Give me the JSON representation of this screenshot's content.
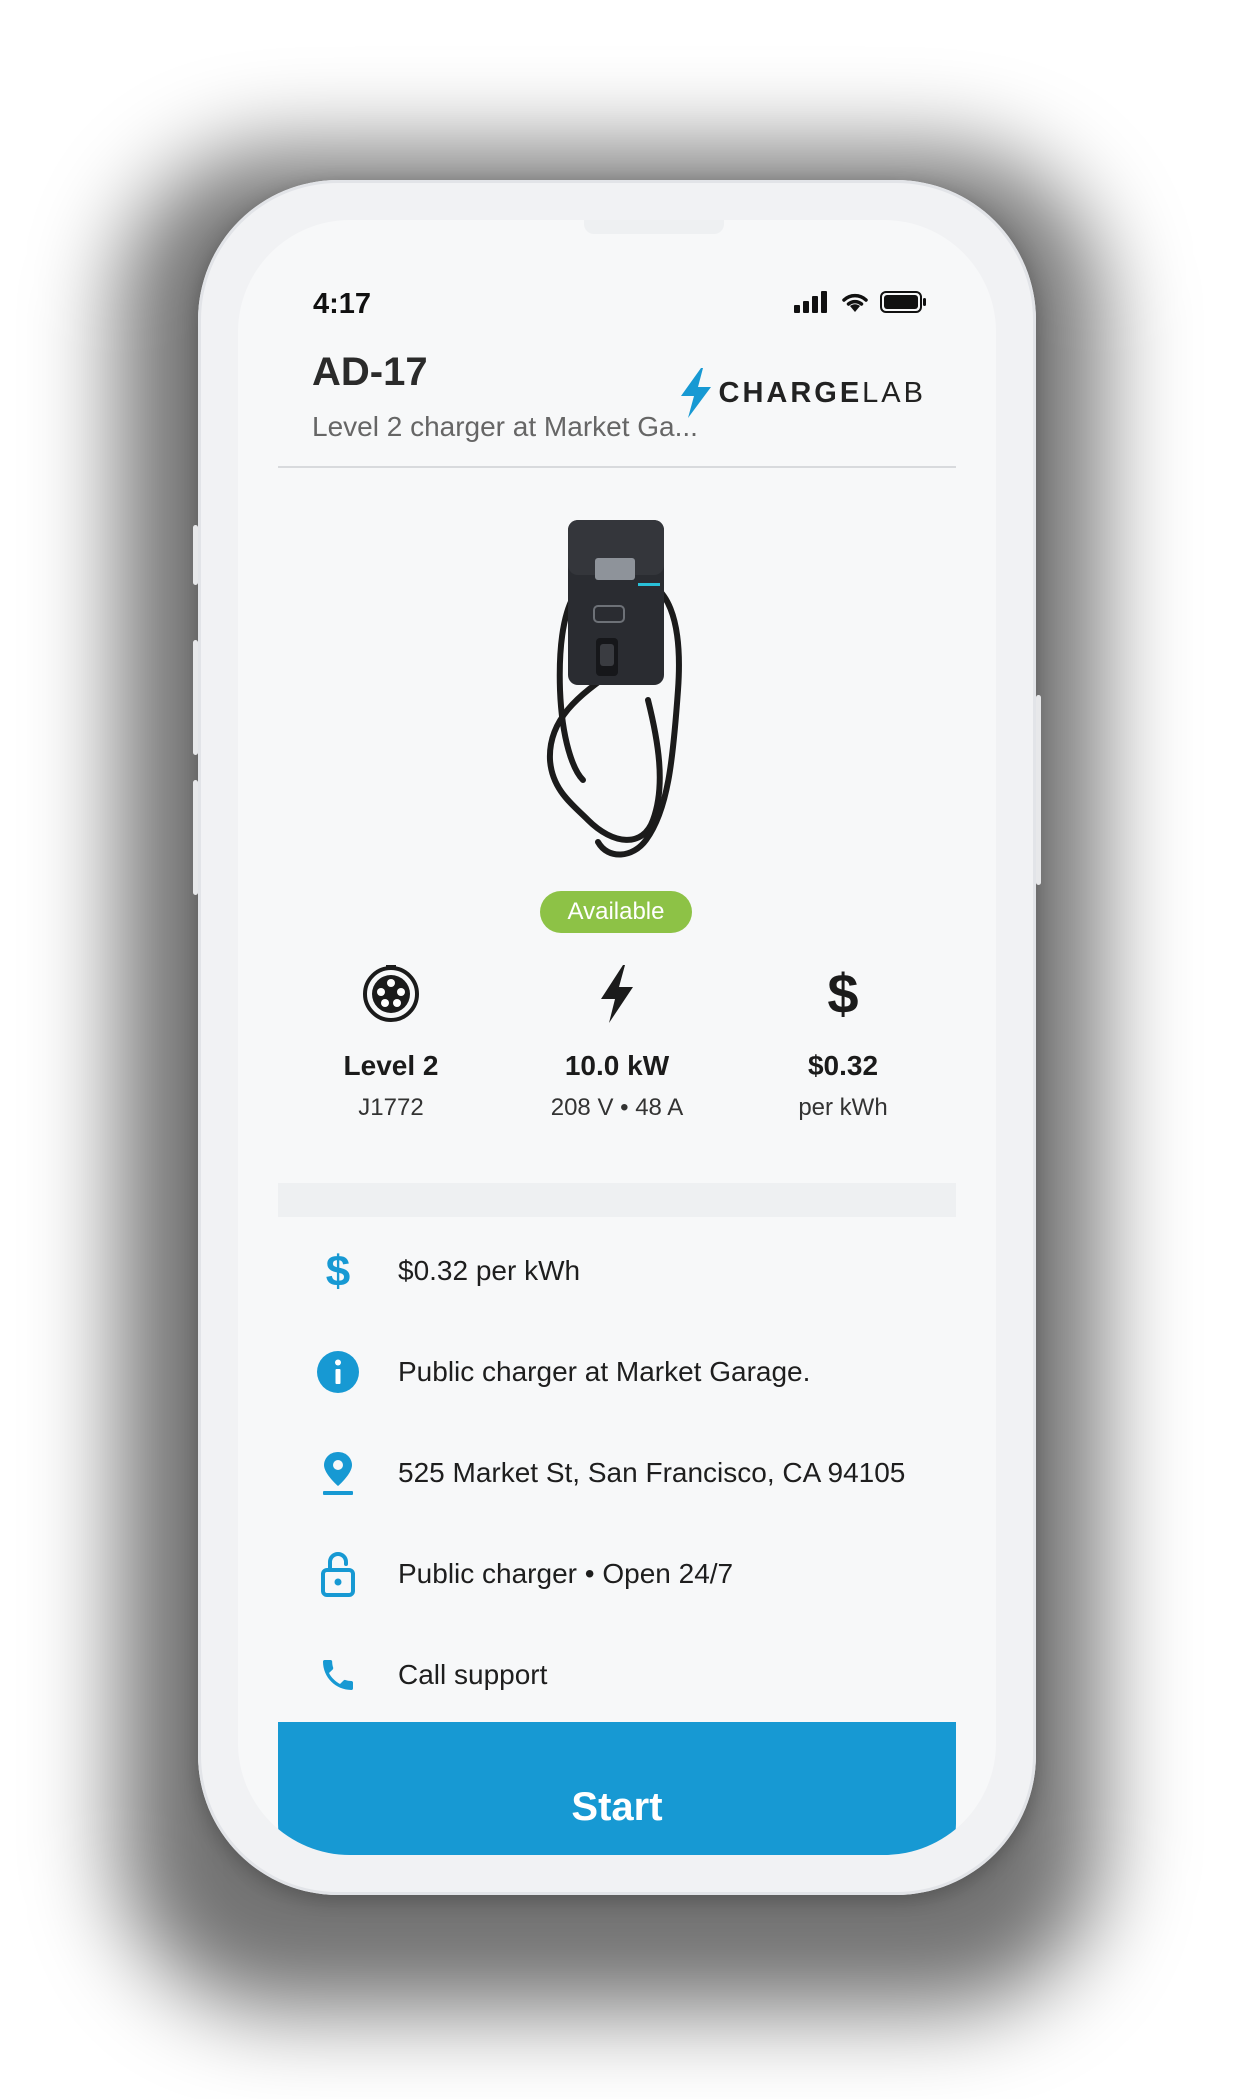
{
  "status_bar": {
    "time": "4:17"
  },
  "header": {
    "charger_id": "AD-17",
    "subtitle": "Level 2 charger at Market Ga...",
    "brand_bold": "CHARGE",
    "brand_light": "LAB"
  },
  "status_badge": {
    "label": "Available",
    "color": "#8dc246"
  },
  "specs": [
    {
      "icon": "connector-icon",
      "value": "Level 2",
      "sub": "J1772"
    },
    {
      "icon": "bolt-icon",
      "value": "10.0 kW",
      "sub": "208 V • 48 A"
    },
    {
      "icon": "dollar-icon",
      "value": "$0.32",
      "sub": "per kWh"
    }
  ],
  "info": [
    {
      "icon": "dollar-icon",
      "text": "$0.32 per kWh"
    },
    {
      "icon": "info-icon",
      "text": "Public charger at Market Garage."
    },
    {
      "icon": "location-pin-icon",
      "text": "525 Market St, San Francisco, CA 94105"
    },
    {
      "icon": "unlock-icon",
      "text": "Public charger • Open 24/7"
    },
    {
      "icon": "phone-icon",
      "text": "Call support"
    }
  ],
  "action": {
    "start_label": "Start"
  },
  "colors": {
    "accent": "#1799d3",
    "available": "#8dc246"
  }
}
